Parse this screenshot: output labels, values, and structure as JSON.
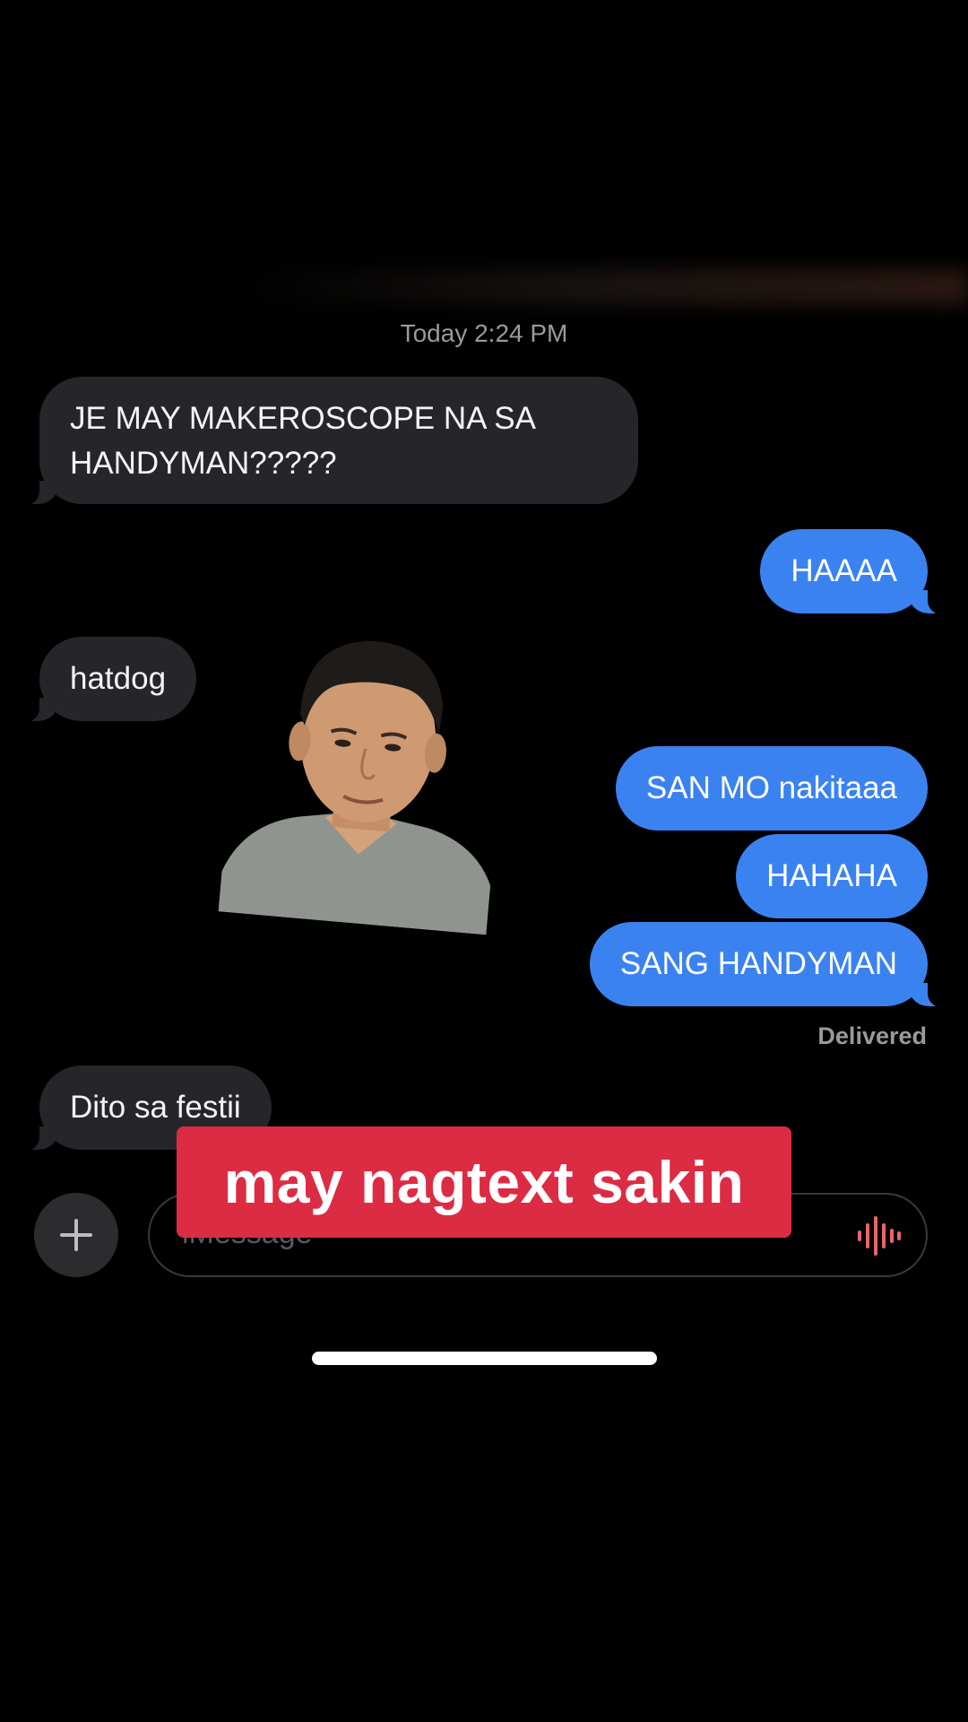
{
  "conversation": {
    "timestamp": "Today 2:24 PM",
    "messages": [
      {
        "direction": "incoming",
        "lines": [
          "JE MAY MAKEROSCOPE NA SA",
          "HANDYMAN?????"
        ]
      },
      {
        "direction": "outgoing",
        "text": "HAAAA"
      },
      {
        "direction": "incoming",
        "text": "hatdog"
      },
      {
        "direction": "outgoing",
        "text": "SAN MO nakitaaa"
      },
      {
        "direction": "outgoing",
        "text": "HAHAHA"
      },
      {
        "direction": "outgoing",
        "text": "SANG HANDYMAN"
      },
      {
        "direction": "incoming",
        "text": "Dito sa festii"
      }
    ],
    "status": "Delivered"
  },
  "composer": {
    "placeholder": "iMessage",
    "plus_icon": "plus-icon",
    "audio_icon": "waveform-icon",
    "audio_color": "#e8656c"
  },
  "caption": {
    "text": "may nagtext sakin",
    "background": "#dc2c43"
  },
  "colors": {
    "outgoing_bubble": "#3b82f1",
    "incoming_bubble": "#26262a",
    "background": "#000000"
  }
}
